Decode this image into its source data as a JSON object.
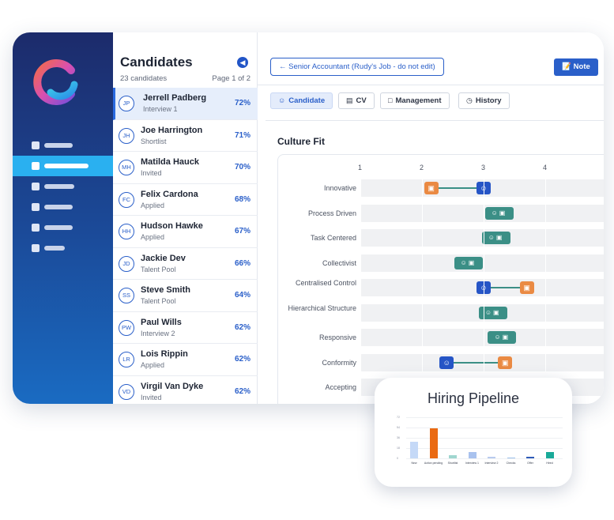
{
  "candidates_panel": {
    "title": "Candidates",
    "count": "23 candidates",
    "page": "Page 1 of 2",
    "items": [
      {
        "initials": "JP",
        "name": "Jerrell Padberg",
        "status": "Interview 1",
        "match": "72%"
      },
      {
        "initials": "JH",
        "name": "Joe Harrington",
        "status": "Shortlist",
        "match": "71%"
      },
      {
        "initials": "MH",
        "name": "Matilda Hauck",
        "status": "Invited",
        "match": "70%"
      },
      {
        "initials": "FC",
        "name": "Felix Cardona",
        "status": "Applied",
        "match": "68%"
      },
      {
        "initials": "HH",
        "name": "Hudson Hawke",
        "status": "Applied",
        "match": "67%"
      },
      {
        "initials": "JD",
        "name": "Jackie Dev",
        "status": "Talent Pool",
        "match": "66%"
      },
      {
        "initials": "SS",
        "name": "Steve Smith",
        "status": "Talent Pool",
        "match": "64%"
      },
      {
        "initials": "PW",
        "name": "Paul Wills",
        "status": "Interview 2",
        "match": "62%"
      },
      {
        "initials": "LR",
        "name": "Lois Rippin",
        "status": "Applied",
        "match": "62%"
      },
      {
        "initials": "VD",
        "name": "Virgil Van Dyke",
        "status": "Invited",
        "match": "62%"
      }
    ]
  },
  "header": {
    "job_button": "← Senior Accountant (Rudy's Job - do not edit)",
    "note_button": "Note"
  },
  "tabs": [
    {
      "icon": "person-icon",
      "label": "Candidate"
    },
    {
      "icon": "document-icon",
      "label": "CV"
    },
    {
      "icon": "briefcase-icon",
      "label": "Management"
    },
    {
      "icon": "clock-icon",
      "label": "History"
    }
  ],
  "culture_fit": {
    "title": "Culture Fit",
    "axis": [
      "1",
      "2",
      "3",
      "4"
    ],
    "rows": [
      {
        "label": "Innovative",
        "candidate": 3.0,
        "company": 2.15
      },
      {
        "label": "Process Driven",
        "candidate": 3.25,
        "company": 3.25
      },
      {
        "label": "Task Centered",
        "candidate": 3.2,
        "company": 3.2
      },
      {
        "label": "Collectivist",
        "candidate": 2.75,
        "company": 2.75
      },
      {
        "label": "Centralised Control",
        "candidate": 3.0,
        "company": 3.7
      },
      {
        "label": "Hierarchical Structure",
        "candidate": 3.15,
        "company": 3.15
      },
      {
        "label": "Responsive",
        "candidate": 3.3,
        "company": 3.3
      },
      {
        "label": "Conformity",
        "candidate": 2.4,
        "company": 3.35
      },
      {
        "label": "Accepting",
        "candidate": null,
        "company": null
      }
    ]
  },
  "pipeline": {
    "title": "Hiring Pipeline",
    "chart_data": {
      "type": "bar",
      "categories": [
        "New",
        "Action pending",
        "Shortlist",
        "Interview 1",
        "Interview 2",
        "Checks",
        "Offer",
        "Hired"
      ],
      "values": [
        29,
        52,
        5,
        11,
        3,
        2,
        3,
        11
      ],
      "ylim": [
        0,
        72
      ],
      "ticks": [
        "72",
        "54",
        "36",
        "18",
        "0"
      ],
      "colors": [
        "#c5d9f7",
        "#ea6a12",
        "#9fd6cf",
        "#a9c2ee",
        "#b9cbee",
        "#9cc0ea",
        "#2e5bb8",
        "#1aaa99"
      ]
    }
  },
  "colors": {
    "sidebar_top": "#1c2b6b",
    "sidebar_active": "#2ab0f0",
    "primary": "#2a5fc9",
    "candidate_marker": "#2655c6",
    "company_marker": "#ea8a43",
    "match_marker": "#3b8f86"
  }
}
